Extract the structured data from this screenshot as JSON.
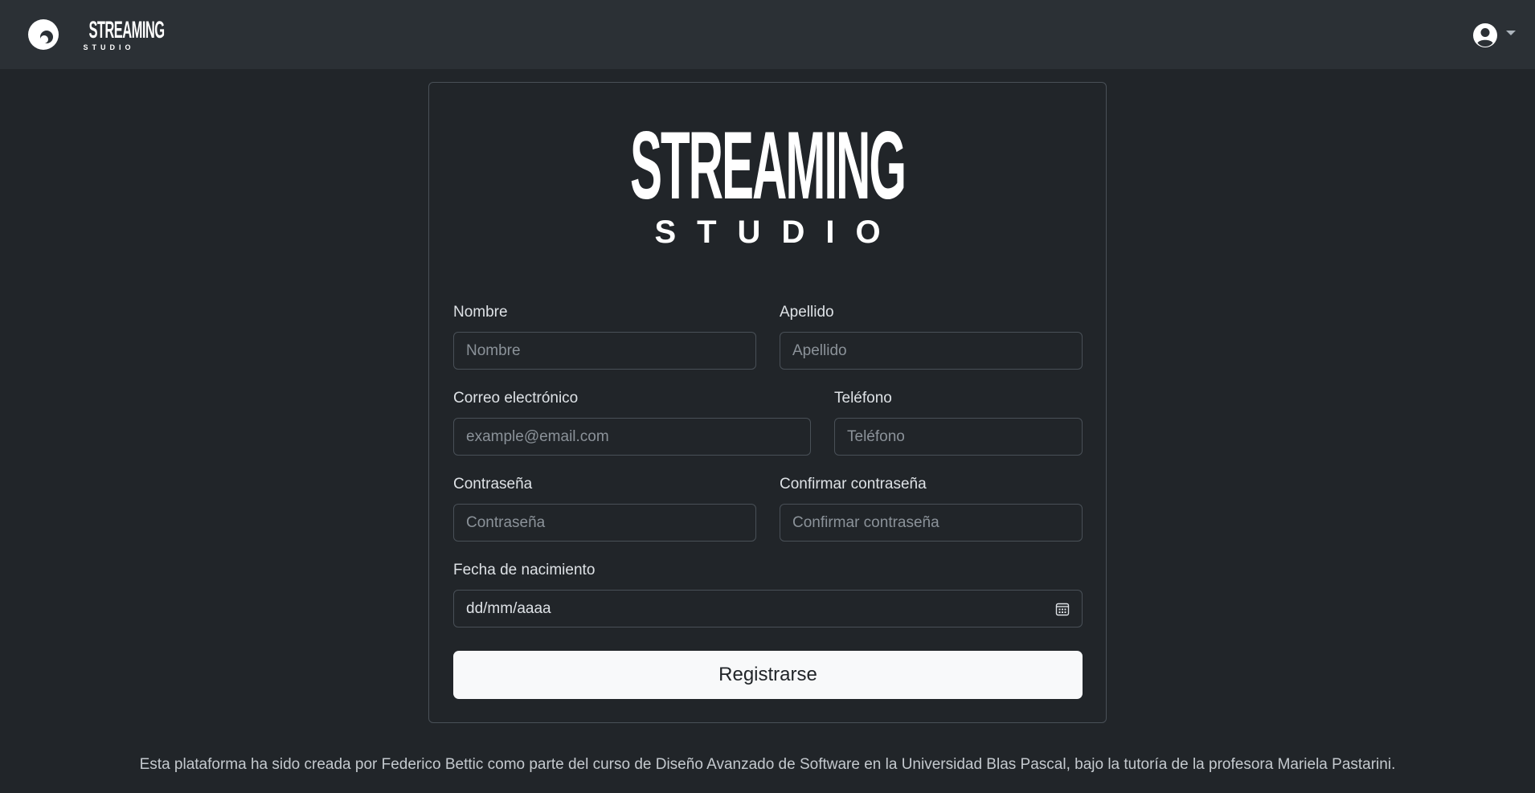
{
  "navbar": {
    "brand": {
      "word": "STREAMING",
      "sub": "STUDIO",
      "logo_icon": "streaming-studio-mark"
    },
    "user_menu": {
      "icon": "user-circle-icon",
      "caret_icon": "caret-down-icon"
    }
  },
  "hero": {
    "word": "STREAMING",
    "sub": "STUDIO"
  },
  "form": {
    "first_name": {
      "label": "Nombre",
      "placeholder": "Nombre",
      "value": ""
    },
    "last_name": {
      "label": "Apellido",
      "placeholder": "Apellido",
      "value": ""
    },
    "email": {
      "label": "Correo electrónico",
      "placeholder": "example@email.com",
      "value": ""
    },
    "phone": {
      "label": "Teléfono",
      "placeholder": "Teléfono",
      "value": ""
    },
    "password": {
      "label": "Contraseña",
      "placeholder": "Contraseña",
      "value": ""
    },
    "confirm_password": {
      "label": "Confirmar contraseña",
      "placeholder": "Confirmar contraseña",
      "value": ""
    },
    "birth_date": {
      "label": "Fecha de nacimiento",
      "display": "dd/mm/aaaa",
      "icon": "calendar-icon"
    },
    "submit_label": "Registrarse"
  },
  "footer": {
    "text": "Esta plataforma ha sido creada por Federico Bettic como parte del curso de Diseño Avanzado de Software en la Universidad Blas Pascal, bajo la tutoría de la profesora Mariela Pastarini."
  },
  "colors": {
    "page_bg": "#212529",
    "navbar_bg": "#2b3035",
    "border": "#495057",
    "button_bg": "#f8f9fa",
    "text": "#dee2e6"
  }
}
